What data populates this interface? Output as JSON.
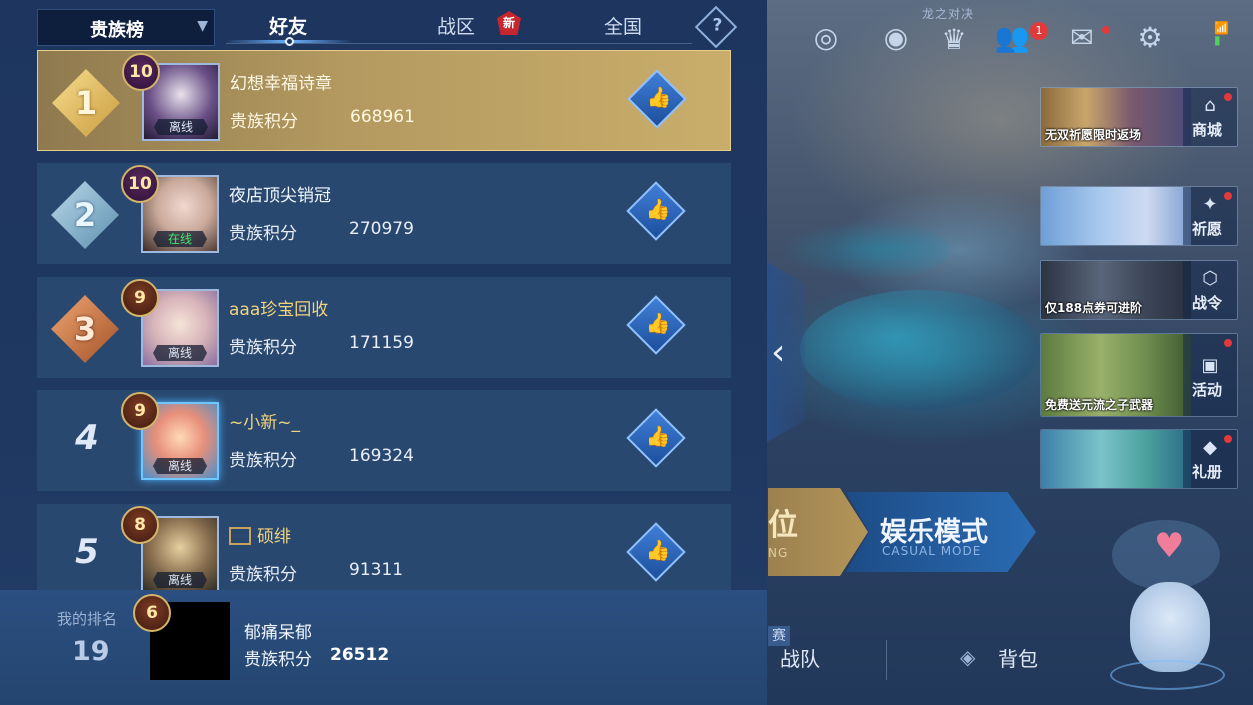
{
  "header": {
    "board_selector": "贵族榜",
    "tabs": [
      {
        "label": "好友",
        "active": true
      },
      {
        "label": "战区",
        "badge": "新"
      },
      {
        "label": "全国"
      }
    ],
    "help": "?"
  },
  "entries": [
    {
      "rank": "1",
      "level": "10",
      "name": "幻想幸福诗章",
      "status": "离线",
      "score_label": "贵族积分",
      "score": "668961"
    },
    {
      "rank": "2",
      "level": "10",
      "name": "夜店顶尖销冠",
      "status": "在线",
      "score_label": "贵族积分",
      "score": "270979"
    },
    {
      "rank": "3",
      "level": "9",
      "name": "aaa珍宝回收",
      "status": "离线",
      "score_label": "贵族积分",
      "score": "171159"
    },
    {
      "rank": "4",
      "level": "9",
      "name": "~小新~_",
      "status": "离线",
      "score_label": "贵族积分",
      "score": "169324"
    },
    {
      "rank": "5",
      "level": "8",
      "name": "硕绯",
      "status": "离线",
      "score_label": "贵族积分",
      "score": "91311"
    }
  ],
  "my_rank": {
    "label": "我的排名",
    "rank": "19",
    "level": "6",
    "name": "郁痛呆郁",
    "score_label": "贵族积分",
    "score": "26512"
  },
  "top_bar": {
    "dragon_label": "龙之对决",
    "friends_notification": "1"
  },
  "promos": [
    {
      "subtitle": "无双祈愿限时返场",
      "label": "商城",
      "icon": "shop-icon"
    },
    {
      "subtitle": "",
      "label": "祈愿",
      "icon": "wish-icon"
    },
    {
      "subtitle": "仅188点券可进阶",
      "label": "战令",
      "icon": "pass-icon"
    },
    {
      "subtitle": "免费送元流之子武器",
      "label": "活动",
      "icon": "event-icon"
    },
    {
      "subtitle": "",
      "label": "礼册",
      "icon": "gift-icon"
    }
  ],
  "modes": {
    "rank_big": "位",
    "rank_small": "NG",
    "casual_big": "娱乐模式",
    "casual_small": "CASUAL MODE"
  },
  "bottom_nav": {
    "tag": "赛",
    "team": "战队",
    "bag": "背包"
  },
  "colors": {
    "panel_bg": "#1d355f",
    "first_row_gold": "#c9ad6b",
    "row_bg": "#29486f",
    "like_blue": "#3f7fd8",
    "online_green": "#47e36a"
  }
}
